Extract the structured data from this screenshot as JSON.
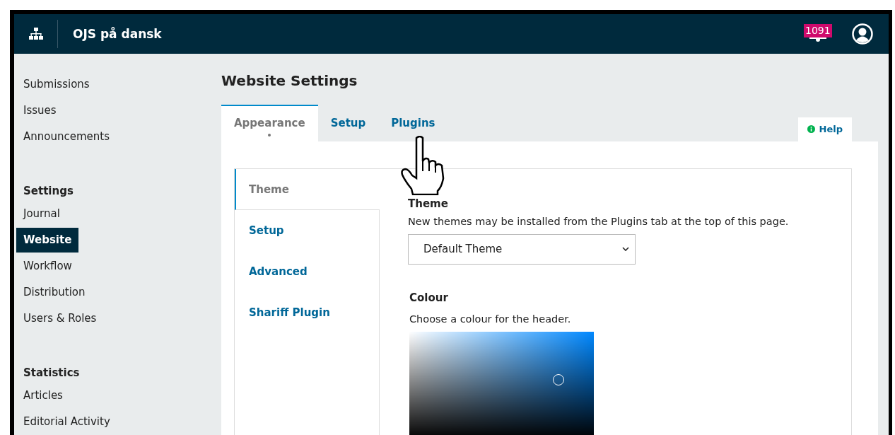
{
  "header": {
    "site_title": "OJS på dansk",
    "notification_count": "1091"
  },
  "sidebar": {
    "groups": [
      {
        "items": [
          {
            "label": "Submissions",
            "selected": false
          },
          {
            "label": "Issues",
            "selected": false
          },
          {
            "label": "Announcements",
            "selected": false
          }
        ]
      },
      {
        "heading": "Settings",
        "items": [
          {
            "label": "Journal",
            "selected": false
          },
          {
            "label": "Website",
            "selected": true
          },
          {
            "label": "Workflow",
            "selected": false
          },
          {
            "label": "Distribution",
            "selected": false
          },
          {
            "label": "Users & Roles",
            "selected": false
          }
        ]
      },
      {
        "heading": "Statistics",
        "items": [
          {
            "label": "Articles",
            "selected": false
          },
          {
            "label": "Editorial Activity",
            "selected": false
          }
        ]
      }
    ]
  },
  "page_title": "Website Settings",
  "tabs": [
    {
      "label": "Appearance",
      "selected": true,
      "modified": true
    },
    {
      "label": "Setup",
      "selected": false,
      "modified": false
    },
    {
      "label": "Plugins",
      "selected": false,
      "modified": false
    }
  ],
  "help_button": "Help",
  "side_tabs": [
    {
      "label": "Theme",
      "selected": true
    },
    {
      "label": "Setup",
      "selected": false
    },
    {
      "label": "Advanced",
      "selected": false
    },
    {
      "label": "Shariff Plugin",
      "selected": false
    }
  ],
  "form": {
    "theme": {
      "label": "Theme",
      "description": "New themes may be installed from the Plugins tab at the top of this page.",
      "value": "Default Theme"
    },
    "colour": {
      "label": "Colour",
      "description": "Choose a colour for the header."
    }
  }
}
